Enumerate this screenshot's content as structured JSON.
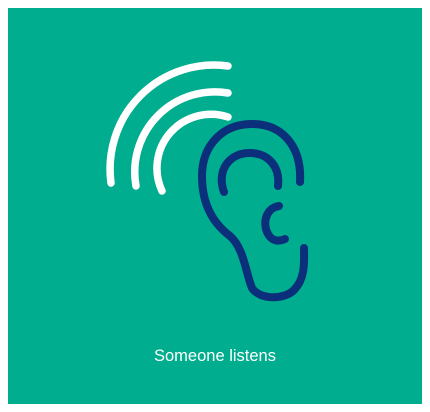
{
  "card": {
    "background_color": "#00ad8e",
    "caption": "Someone listens",
    "icon": "ear-with-sound-waves-icon",
    "wave_color": "#ffffff",
    "ear_color": "#0b2f7a"
  }
}
